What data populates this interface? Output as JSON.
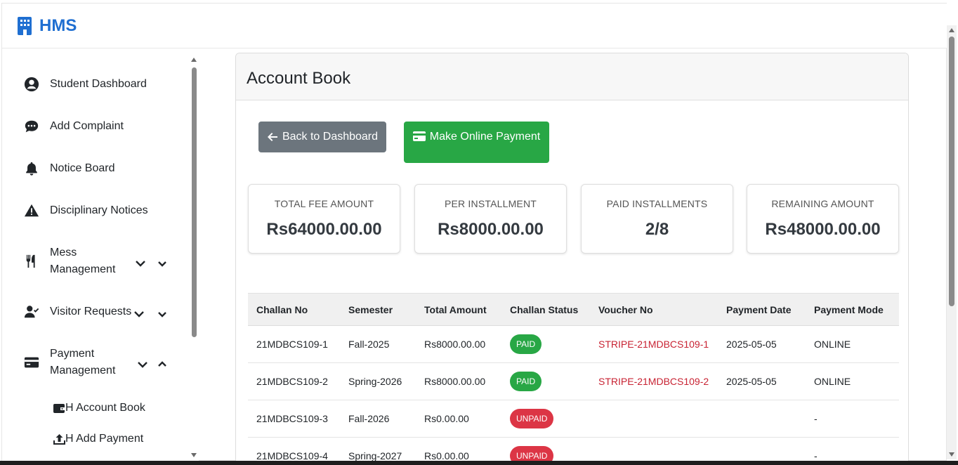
{
  "brand": {
    "name": "HMS"
  },
  "sidebar": {
    "items": [
      {
        "label": "Student Dashboard",
        "icon": "user-circle-icon"
      },
      {
        "label": "Add Complaint",
        "icon": "comment-dots-icon"
      },
      {
        "label": "Notice Board",
        "icon": "bell-icon"
      },
      {
        "label": "Disciplinary Notices",
        "icon": "warning-icon"
      },
      {
        "label_line1": "Mess",
        "label_line2": "Management",
        "icon": "utensils-icon"
      },
      {
        "label": "Visitor Requests",
        "icon": "user-check-icon"
      },
      {
        "label_line1": "Payment",
        "label_line2": "Management",
        "icon": "credit-card-icon"
      }
    ],
    "subitems": [
      {
        "label": "H Account Book",
        "icon": "wallet-icon"
      },
      {
        "label": "H Add Payment",
        "icon": "upload-icon"
      }
    ]
  },
  "page": {
    "title": "Account Book",
    "back_button": "Back to Dashboard",
    "pay_button": "Make Online Payment"
  },
  "stats": [
    {
      "label": "Total Fee Amount",
      "value": "Rs64000.00.00"
    },
    {
      "label": "Per Installment",
      "value": "Rs8000.00.00"
    },
    {
      "label": "Paid Installments",
      "value": "2/8"
    },
    {
      "label": "Remaining Amount",
      "value": "Rs48000.00.00"
    }
  ],
  "table": {
    "headers": [
      "Challan No",
      "Semester",
      "Total Amount",
      "Challan Status",
      "Voucher No",
      "Payment Date",
      "Payment Mode"
    ],
    "rows": [
      {
        "challan": "21MDBCS109-1",
        "semester": "Fall-2025",
        "amount": "Rs8000.00.00",
        "status": "PAID",
        "voucher": "STRIPE-21MDBCS109-1",
        "date": "2025-05-05",
        "mode": "ONLINE"
      },
      {
        "challan": "21MDBCS109-2",
        "semester": "Spring-2026",
        "amount": "Rs8000.00.00",
        "status": "PAID",
        "voucher": "STRIPE-21MDBCS109-2",
        "date": "2025-05-05",
        "mode": "ONLINE"
      },
      {
        "challan": "21MDBCS109-3",
        "semester": "Fall-2026",
        "amount": "Rs0.00.00",
        "status": "UNPAID",
        "voucher": "",
        "date": "",
        "mode": "-"
      },
      {
        "challan": "21MDBCS109-4",
        "semester": "Spring-2027",
        "amount": "Rs0.00.00",
        "status": "UNPAID",
        "voucher": "",
        "date": "",
        "mode": "-"
      }
    ]
  },
  "colors": {
    "brand": "#1f6fd1",
    "success": "#28a745",
    "secondary": "#6c757d",
    "danger": "#dc3545"
  }
}
